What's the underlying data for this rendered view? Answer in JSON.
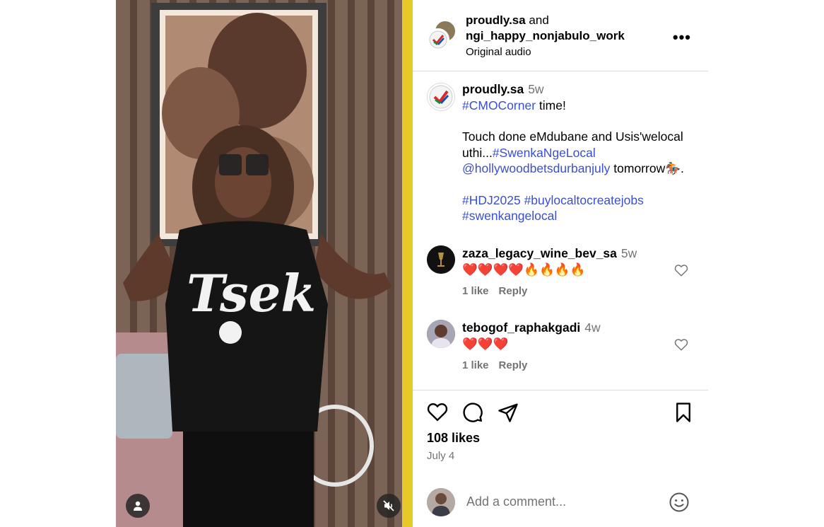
{
  "post": {
    "header": {
      "author": "proudly.sa",
      "joiner": " and",
      "collaborator": "ngi_happy_nonjabulo_work",
      "audio": "Original audio",
      "more_label": "•••"
    },
    "caption": {
      "username": "proudly.sa",
      "age": "5w",
      "hashtag_1": "#CMOCorner",
      "line1_rest": " time!",
      "line2": "Touch done eMdubane and Usis'welocal uthi...",
      "hashtag_2": "#SwenkaNgeLocal",
      "mention": "@hollywoodbetsdurbanjuly",
      "line3_rest": " tomorrow🏇.",
      "hashtag_3": "#HDJ2025",
      "hashtag_4": "#buylocaltocreatejobs",
      "hashtag_5": "#swenkangelocal"
    },
    "comments": [
      {
        "username": "zaza_legacy_wine_bev_sa",
        "age": "5w",
        "text": "❤️❤️❤️❤️🔥🔥🔥🔥",
        "likes": "1 like",
        "reply": "Reply"
      },
      {
        "username": "tebogof_raphakgadi",
        "age": "4w",
        "text": "❤️❤️❤️",
        "likes": "1 like",
        "reply": "Reply"
      }
    ],
    "likes_count": "108 likes",
    "date": "July 4",
    "add_comment_placeholder": "Add a comment..."
  },
  "icons": {
    "like": "heart-icon",
    "comment": "comment-icon",
    "share": "share-icon",
    "save": "bookmark-icon",
    "emoji": "emoji-icon",
    "user_tag": "user-icon",
    "mute": "muted-speaker-icon"
  },
  "colors": {
    "link": "#3b4fcc",
    "muted": "#737373",
    "divider": "#dbdbdb"
  }
}
